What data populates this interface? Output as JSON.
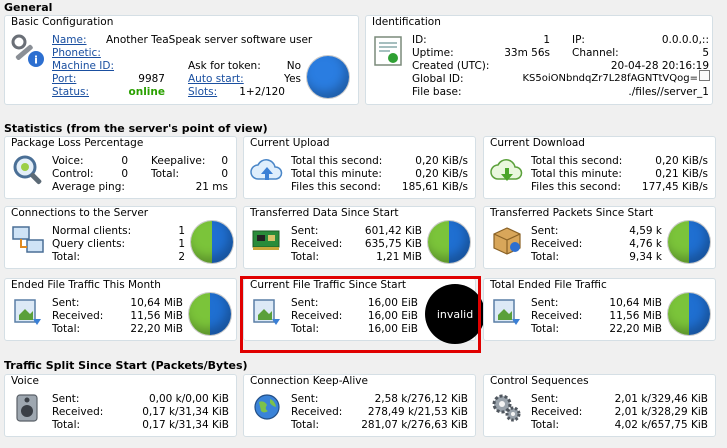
{
  "general": {
    "title": "General",
    "basic": {
      "title": "Basic Configuration",
      "name_label": "Name:",
      "name_value": "Another TeaSpeak server software user",
      "phonetic_label": "Phonetic:",
      "machine_label": "Machine ID:",
      "port_label": "Port:",
      "port_value": "9987",
      "status_label": "Status:",
      "status_value": "online",
      "token_label": "Ask for token:",
      "token_value": "No",
      "autostart_label": "Auto start:",
      "autostart_value": "Yes",
      "slots_label": "Slots:",
      "slots_value": "1+2/120"
    },
    "ident": {
      "title": "Identification",
      "id_label": "ID:",
      "id_value": "1",
      "ip_label": "IP:",
      "ip_value": "0.0.0.0,::",
      "uptime_label": "Uptime:",
      "uptime_value": "33m 56s",
      "channel_label": "Channel:",
      "channel_value": "5",
      "created_label": "Created (UTC):",
      "created_value": "20-04-28 20:16:19",
      "globalid_label": "Global ID:",
      "globalid_value": "KS5oiONbndqZr7L28fAGNTtVQog=",
      "filebase_label": "File base:",
      "filebase_value": "./files//server_1"
    }
  },
  "stats": {
    "title": "Statistics (from the server's point of view)",
    "packet_loss": {
      "title": "Package Loss Percentage",
      "voice_label": "Voice:",
      "voice_value": "0",
      "keepalive_label": "Keepalive:",
      "keepalive_value": "0",
      "control_label": "Control:",
      "control_value": "0",
      "total_label": "Total:",
      "total_value": "0",
      "ping_label": "Average ping:",
      "ping_value": "21 ms"
    },
    "upload": {
      "title": "Current Upload",
      "sec_label": "Total this second:",
      "sec_value": "0,20 KiB/s",
      "min_label": "Total this minute:",
      "min_value": "0,20 KiB/s",
      "files_label": "Files this second:",
      "files_value": "185,61 KiB/s"
    },
    "download": {
      "title": "Current Download",
      "sec_label": "Total this second:",
      "sec_value": "0,20 KiB/s",
      "min_label": "Total this minute:",
      "min_value": "0,21 KiB/s",
      "files_label": "Files this second:",
      "files_value": "177,45 KiB/s"
    },
    "connections": {
      "title": "Connections to the Server",
      "normal_label": "Normal clients:",
      "normal_value": "1",
      "query_label": "Query clients:",
      "query_value": "1",
      "total_label": "Total:",
      "total_value": "2"
    },
    "transferred": {
      "title": "Transferred Data Since Start",
      "sent_label": "Sent:",
      "sent_value": "601,42 KiB",
      "recv_label": "Received:",
      "recv_value": "635,75 KiB",
      "total_label": "Total:",
      "total_value": "1,21 MiB"
    },
    "packets": {
      "title": "Transferred Packets Since Start",
      "sent_label": "Sent:",
      "sent_value": "4,59 k",
      "recv_label": "Received:",
      "recv_value": "4,76 k",
      "total_label": "Total:",
      "total_value": "9,34 k"
    },
    "ended_month": {
      "title": "Ended File Traffic This Month",
      "sent_label": "Sent:",
      "sent_value": "10,64 MiB",
      "recv_label": "Received:",
      "recv_value": "11,56 MiB",
      "total_label": "Total:",
      "total_value": "22,20 MiB"
    },
    "current_file": {
      "title": "Current File Traffic Since Start",
      "sent_label": "Sent:",
      "sent_value": "16,00 EiB",
      "recv_label": "Received:",
      "recv_value": "16,00 EiB",
      "total_label": "Total:",
      "total_value": "16,00 EiB",
      "chart_label": "invalid"
    },
    "total_ended": {
      "title": "Total Ended File Traffic",
      "sent_label": "Sent:",
      "sent_value": "10,64 MiB",
      "recv_label": "Received:",
      "recv_value": "11,56 MiB",
      "total_label": "Total:",
      "total_value": "22,20 MiB"
    }
  },
  "split": {
    "title": "Traffic Split Since Start (Packets/Bytes)",
    "voice": {
      "title": "Voice",
      "sent_label": "Sent:",
      "sent_value": "0,00 k/0,00 KiB",
      "recv_label": "Received:",
      "recv_value": "0,17 k/31,34 KiB",
      "total_label": "Total:",
      "total_value": "0,17 k/31,34 KiB"
    },
    "keepalive": {
      "title": "Connection Keep-Alive",
      "sent_label": "Sent:",
      "sent_value": "2,58 k/276,12 KiB",
      "recv_label": "Received:",
      "recv_value": "278,49 k/21,53 KiB",
      "total_label": "Total:",
      "total_value": "281,07 k/276,63 KiB"
    },
    "control": {
      "title": "Control Sequences",
      "sent_label": "Sent:",
      "sent_value": "2,01 k/329,46 KiB",
      "recv_label": "Received:",
      "recv_value": "2,01 k/328,29 KiB",
      "total_label": "Total:",
      "total_value": "4,02 k/657,75 KiB"
    }
  }
}
